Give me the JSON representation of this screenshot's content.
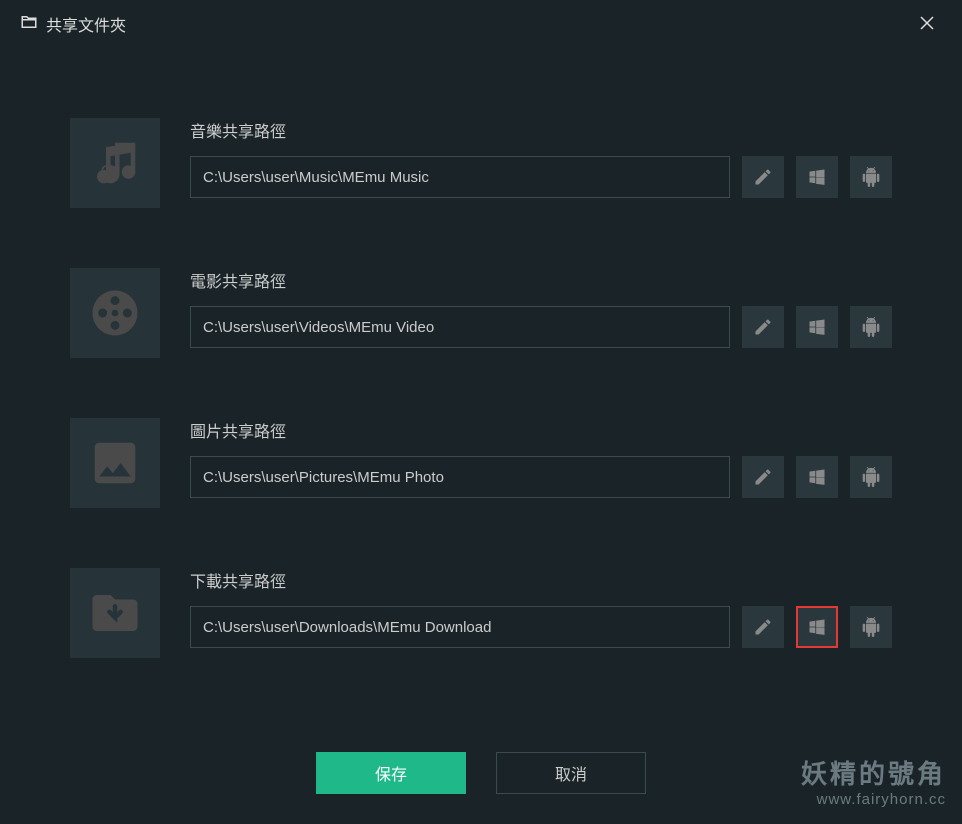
{
  "window": {
    "title": "共享文件夾"
  },
  "folders": {
    "music": {
      "label": "音樂共享路徑",
      "path": "C:\\Users\\user\\Music\\MEmu Music"
    },
    "video": {
      "label": "電影共享路徑",
      "path": "C:\\Users\\user\\Videos\\MEmu Video"
    },
    "photo": {
      "label": "圖片共享路徑",
      "path": "C:\\Users\\user\\Pictures\\MEmu Photo"
    },
    "download": {
      "label": "下載共享路徑",
      "path": "C:\\Users\\user\\Downloads\\MEmu Download"
    }
  },
  "buttons": {
    "save": "保存",
    "cancel": "取消"
  },
  "watermark": {
    "main": "妖精的號角",
    "sub": "www.fairyhorn.cc"
  }
}
